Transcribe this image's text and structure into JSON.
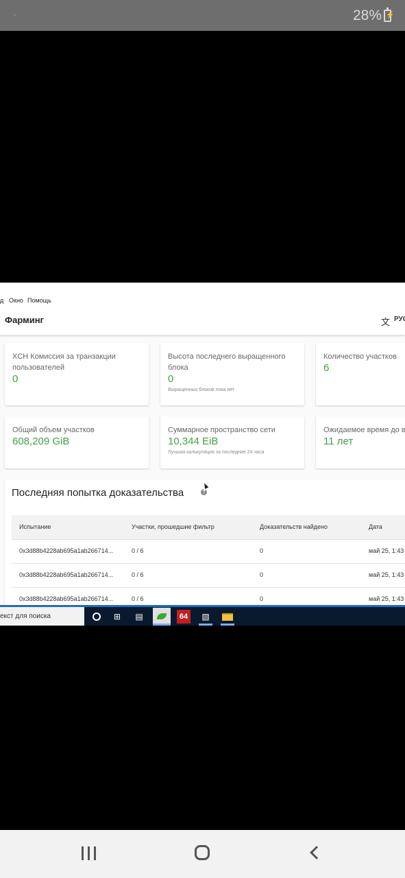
{
  "phone": {
    "battery_label": "28%"
  },
  "menu": {
    "items": [
      "д",
      "Окно",
      "Помощь"
    ]
  },
  "header": {
    "title": "Фарминг",
    "language_label": "РУС"
  },
  "cards": [
    {
      "label": "XCH Комиссия за транзакции пользователей",
      "value": "0",
      "note": ""
    },
    {
      "label": "Высота последнего выращенного блока",
      "value": "0",
      "note": "Выращенных блоков пока нет"
    },
    {
      "label": "Количество участков",
      "value": "6",
      "note": ""
    },
    {
      "label": "Общий объем участков",
      "value": "608,209 GiB",
      "note": ""
    },
    {
      "label": "Суммарное пространство сети",
      "value": "10,344 EiB",
      "note": "Лучшая калькуляция за последние 24 часа"
    },
    {
      "label": "Ожидаемое время до вы",
      "value": "11 лет",
      "note": ""
    }
  ],
  "proofs": {
    "title": "Последняя попытка доказательства",
    "help_symbol": "?",
    "columns": [
      "Испытание",
      "Участки, прошедшие фильтр",
      "Доказательств найдено",
      "Дата"
    ],
    "rows": [
      [
        "0x3d88b4228ab695a1ab266714...",
        "0 / 6",
        "0",
        "май 25, 1:43"
      ],
      [
        "0x3d88b4228ab695a1ab266714...",
        "0 / 6",
        "0",
        "май 25, 1:43"
      ],
      [
        "0x3d88b4228ab695a1ab266714...",
        "0 / 6",
        "0",
        "май 25, 1:43"
      ]
    ]
  },
  "taskbar": {
    "search_placeholder": "екст для поиска",
    "badge_64": "64"
  },
  "colors": {
    "accent_green": "#43a047",
    "taskbar_bg": "#0a1a2e",
    "status_bar": "#6e6e6e"
  }
}
